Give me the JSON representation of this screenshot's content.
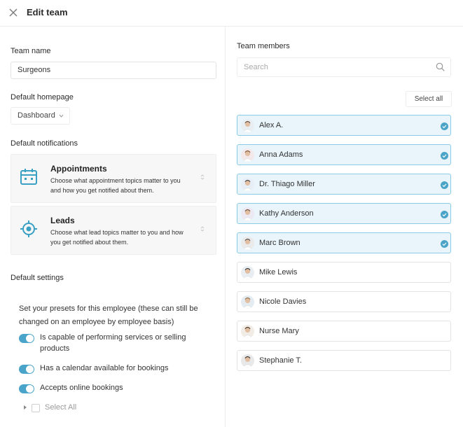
{
  "header": {
    "title": "Edit team"
  },
  "team_name": {
    "label": "Team name",
    "value": "Surgeons"
  },
  "homepage": {
    "label": "Default homepage",
    "value": "Dashboard"
  },
  "notifications": {
    "label": "Default notifications",
    "items": [
      {
        "title": "Appointments",
        "description": "Choose what appointment topics matter to you and how you get notified about them."
      },
      {
        "title": "Leads",
        "description": "Choose what lead topics matter to you and how you get notified about them."
      }
    ]
  },
  "settings": {
    "label": "Default settings",
    "intro": "Set your presets for this employee (these can still be changed on an employee by employee basis)",
    "toggles": [
      {
        "label": "Is capable of performing services or selling products",
        "on": true
      },
      {
        "label": "Has a calendar available for bookings",
        "on": true
      },
      {
        "label": "Accepts online bookings",
        "on": true
      }
    ],
    "select_all_label": "Select All"
  },
  "members": {
    "label": "Team members",
    "search_placeholder": "Search",
    "select_all_button": "Select all",
    "list": [
      {
        "name": "Alex A.",
        "selected": true
      },
      {
        "name": "Anna Adams",
        "selected": true
      },
      {
        "name": "Dr. Thiago Miller",
        "selected": true
      },
      {
        "name": "Kathy Anderson",
        "selected": true
      },
      {
        "name": "Marc Brown",
        "selected": true
      },
      {
        "name": "Mike Lewis",
        "selected": false
      },
      {
        "name": "Nicole Davies",
        "selected": false
      },
      {
        "name": "Nurse Mary",
        "selected": false
      },
      {
        "name": "Stephanie T.",
        "selected": false
      }
    ]
  },
  "colors": {
    "accent": "#4aa3c8",
    "selected_bg": "#e9f5fb",
    "selected_border": "#8ccbe6",
    "icon": "#3aa0c4"
  },
  "icons": {
    "close": "close-icon",
    "calendar": "calendar-icon",
    "target": "target-icon",
    "search": "search-icon",
    "check": "check-circle-icon"
  }
}
